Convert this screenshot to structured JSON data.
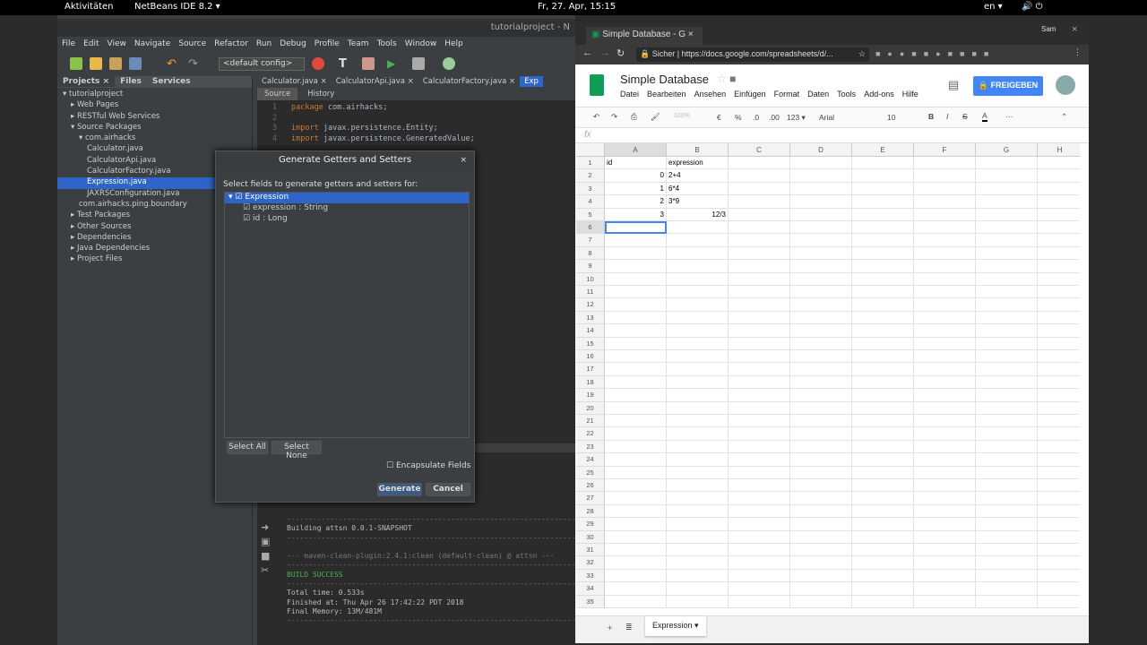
{
  "topbar": {
    "activities": "Aktivitäten",
    "app": "NetBeans IDE 8.2 ▾",
    "clock": "Fr, 27. Apr, 15:15",
    "lang": "en ▾"
  },
  "netbeans": {
    "title": "tutorialproject - N",
    "menu": [
      "File",
      "Edit",
      "View",
      "Navigate",
      "Source",
      "Refactor",
      "Run",
      "Debug",
      "Profile",
      "Team",
      "Tools",
      "Window",
      "Help"
    ],
    "config": "<default config>",
    "panel_tabs": [
      "Projects ×",
      "Files",
      "Services"
    ],
    "tree": [
      {
        "label": "▾ tutorialproject",
        "indent": 0
      },
      {
        "label": "▸ Web Pages",
        "indent": 1
      },
      {
        "label": "▸ RESTful Web Services",
        "indent": 1
      },
      {
        "label": "▾ Source Packages",
        "indent": 1
      },
      {
        "label": "▾ com.airhacks",
        "indent": 2
      },
      {
        "label": "Calculator.java",
        "indent": 3
      },
      {
        "label": "CalculatorApi.java",
        "indent": 3
      },
      {
        "label": "CalculatorFactory.java",
        "indent": 3
      },
      {
        "label": "Expression.java",
        "indent": 3,
        "selected": true
      },
      {
        "label": "JAXRSConfiguration.java",
        "indent": 3
      },
      {
        "label": "com.airhacks.ping.boundary",
        "indent": 2
      },
      {
        "label": "▸ Test Packages",
        "indent": 1
      },
      {
        "label": "▸ Other Sources",
        "indent": 1
      },
      {
        "label": "▸ Dependencies",
        "indent": 1
      },
      {
        "label": "▸ Java Dependencies",
        "indent": 1
      },
      {
        "label": "▸ Project Files",
        "indent": 1
      }
    ],
    "editor_tabs": [
      "Calculator.java ×",
      "CalculatorApi.java ×",
      "CalculatorFactory.java ×",
      "Exp"
    ],
    "editor_modes": [
      "Source",
      "History"
    ],
    "code": [
      {
        "n": "1",
        "kw": "package",
        "rest": " com.airhacks;"
      },
      {
        "n": "2",
        "kw": "",
        "rest": ""
      },
      {
        "n": "3",
        "kw": "import",
        "rest": " javax.persistence.Entity;"
      },
      {
        "n": "4",
        "kw": "import",
        "rest": " javax.persistence.GeneratedValue;"
      }
    ],
    "output": [
      "------------------------------------------------------------------------",
      "Building attsn 0.0.1-SNAPSHOT",
      "------------------------------------------------------------------------",
      "",
      "--- maven-clean-plugin:2.4.1:clean (default-clean) @ attsn ---",
      "------------------------------------------------------------------------",
      "BUILD SUCCESS",
      "------------------------------------------------------------------------",
      "Total time: 0.533s",
      "Finished at: Thu Apr 26 17:42:22 PDT 2018",
      "Final Memory: 13M/481M",
      "------------------------------------------------------------------------"
    ]
  },
  "dialog": {
    "title": "Generate Getters and Setters",
    "prompt": "Select fields to generate getters and setters for:",
    "root": "Expression",
    "fields": [
      "expression : String",
      "id : Long"
    ],
    "select_all": "Select All",
    "select_none": "Select None",
    "encapsulate": "Encapsulate Fields",
    "generate": "Generate",
    "cancel": "Cancel"
  },
  "chrome": {
    "tab": "Simple Database - G",
    "user": "Sam",
    "secure": "Sicher",
    "url": "https://docs.google.com/spreadsheets/d/..."
  },
  "sheets": {
    "title": "Simple Database",
    "menu": [
      "Datei",
      "Bearbeiten",
      "Ansehen",
      "Einfügen",
      "Format",
      "Daten",
      "Tools",
      "Add-ons",
      "Hilfe"
    ],
    "share": "🔒 FREIGEBEN",
    "zoom": "100%",
    "currency": "€",
    "percent": "%",
    "dec1": ".0",
    "dec2": ".00",
    "numfmt": "123 ▾",
    "font": "Arial",
    "size": "10",
    "fx": "fx",
    "columns": [
      "A",
      "B",
      "C",
      "D",
      "E",
      "F",
      "G",
      "H"
    ],
    "row_count": 35,
    "cells": [
      [
        "id",
        "expression"
      ],
      [
        "0",
        "2+4"
      ],
      [
        "1",
        "6*4"
      ],
      [
        "2",
        "3*9"
      ],
      [
        "3",
        "12/3"
      ]
    ],
    "sheet_tab": "Expression ▾",
    "accent": "#4285f4"
  }
}
